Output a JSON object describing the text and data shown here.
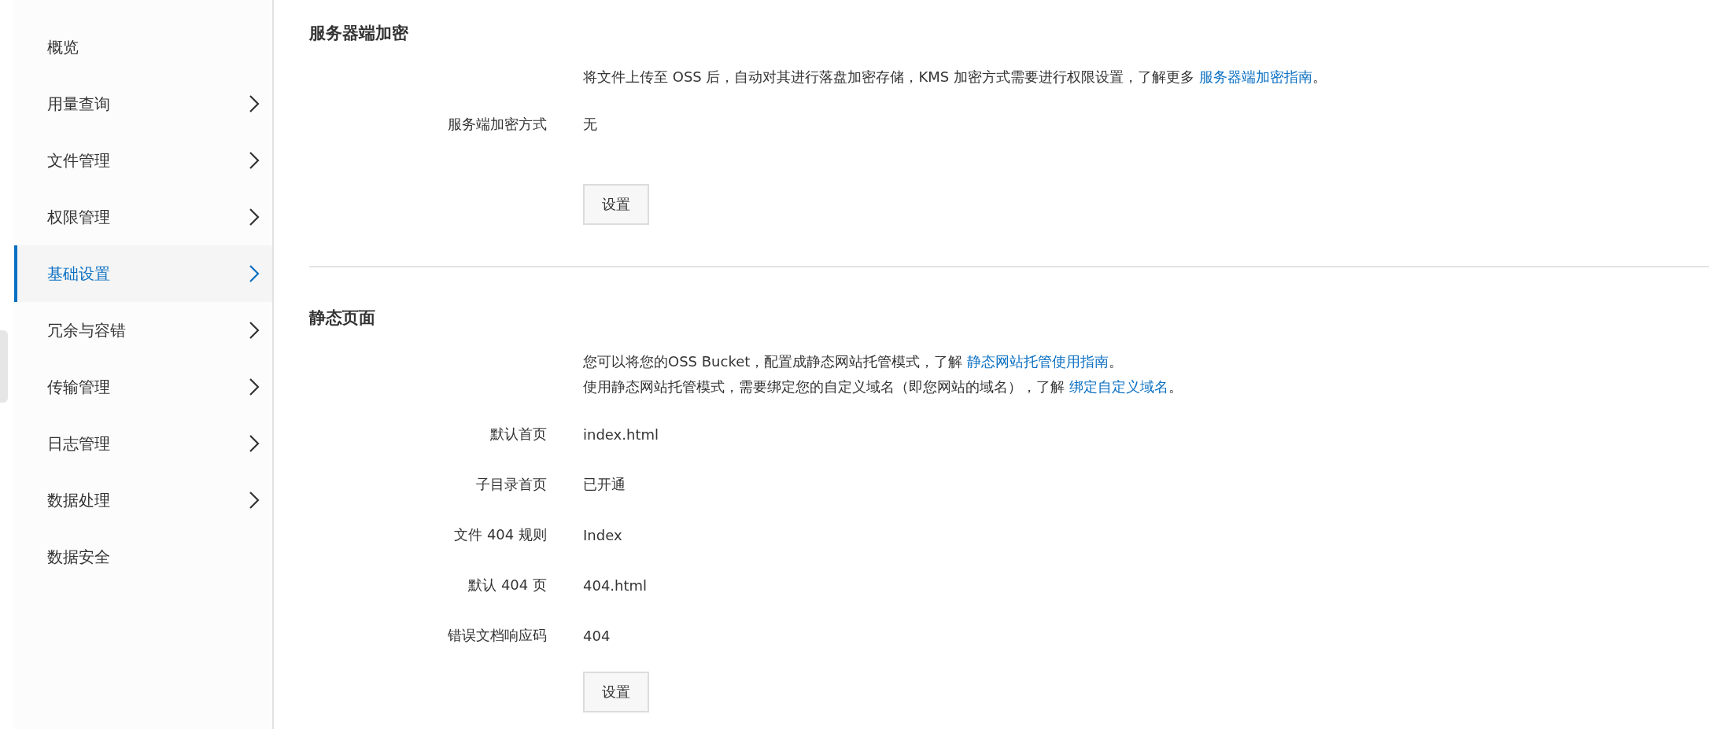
{
  "sidebar": {
    "items": [
      {
        "label": "概览",
        "has_children": false,
        "selected": false
      },
      {
        "label": "用量查询",
        "has_children": true,
        "selected": false
      },
      {
        "label": "文件管理",
        "has_children": true,
        "selected": false
      },
      {
        "label": "权限管理",
        "has_children": true,
        "selected": false
      },
      {
        "label": "基础设置",
        "has_children": true,
        "selected": true
      },
      {
        "label": "冗余与容错",
        "has_children": true,
        "selected": false
      },
      {
        "label": "传输管理",
        "has_children": true,
        "selected": false
      },
      {
        "label": "日志管理",
        "has_children": true,
        "selected": false
      },
      {
        "label": "数据处理",
        "has_children": true,
        "selected": false
      },
      {
        "label": "数据安全",
        "has_children": false,
        "selected": false
      }
    ]
  },
  "sections": [
    {
      "title": "服务器端加密",
      "descriptions": [
        {
          "text": "将文件上传至 OSS 后，自动对其进行落盘加密存储，KMS 加密方式需要进行权限设置，了解更多 ",
          "link": "服务器端加密指南",
          "suffix": "。"
        }
      ],
      "fields": [
        {
          "label": "服务端加密方式",
          "value": "无"
        }
      ],
      "button": "设置"
    },
    {
      "title": "静态页面",
      "descriptions": [
        {
          "text": "您可以将您的OSS Bucket，配置成静态网站托管模式，了解 ",
          "link": "静态网站托管使用指南",
          "suffix": "。"
        },
        {
          "text": "使用静态网站托管模式，需要绑定您的自定义域名（即您网站的域名），了解 ",
          "link": "绑定自定义域名",
          "suffix": "。"
        }
      ],
      "fields": [
        {
          "label": "默认首页",
          "value": "index.html"
        },
        {
          "label": "子目录首页",
          "value": "已开通"
        },
        {
          "label": "文件 404 规则",
          "value": "Index"
        },
        {
          "label": "默认 404 页",
          "value": "404.html"
        },
        {
          "label": "错误文档响应码",
          "value": "404"
        }
      ],
      "button": "设置"
    }
  ]
}
